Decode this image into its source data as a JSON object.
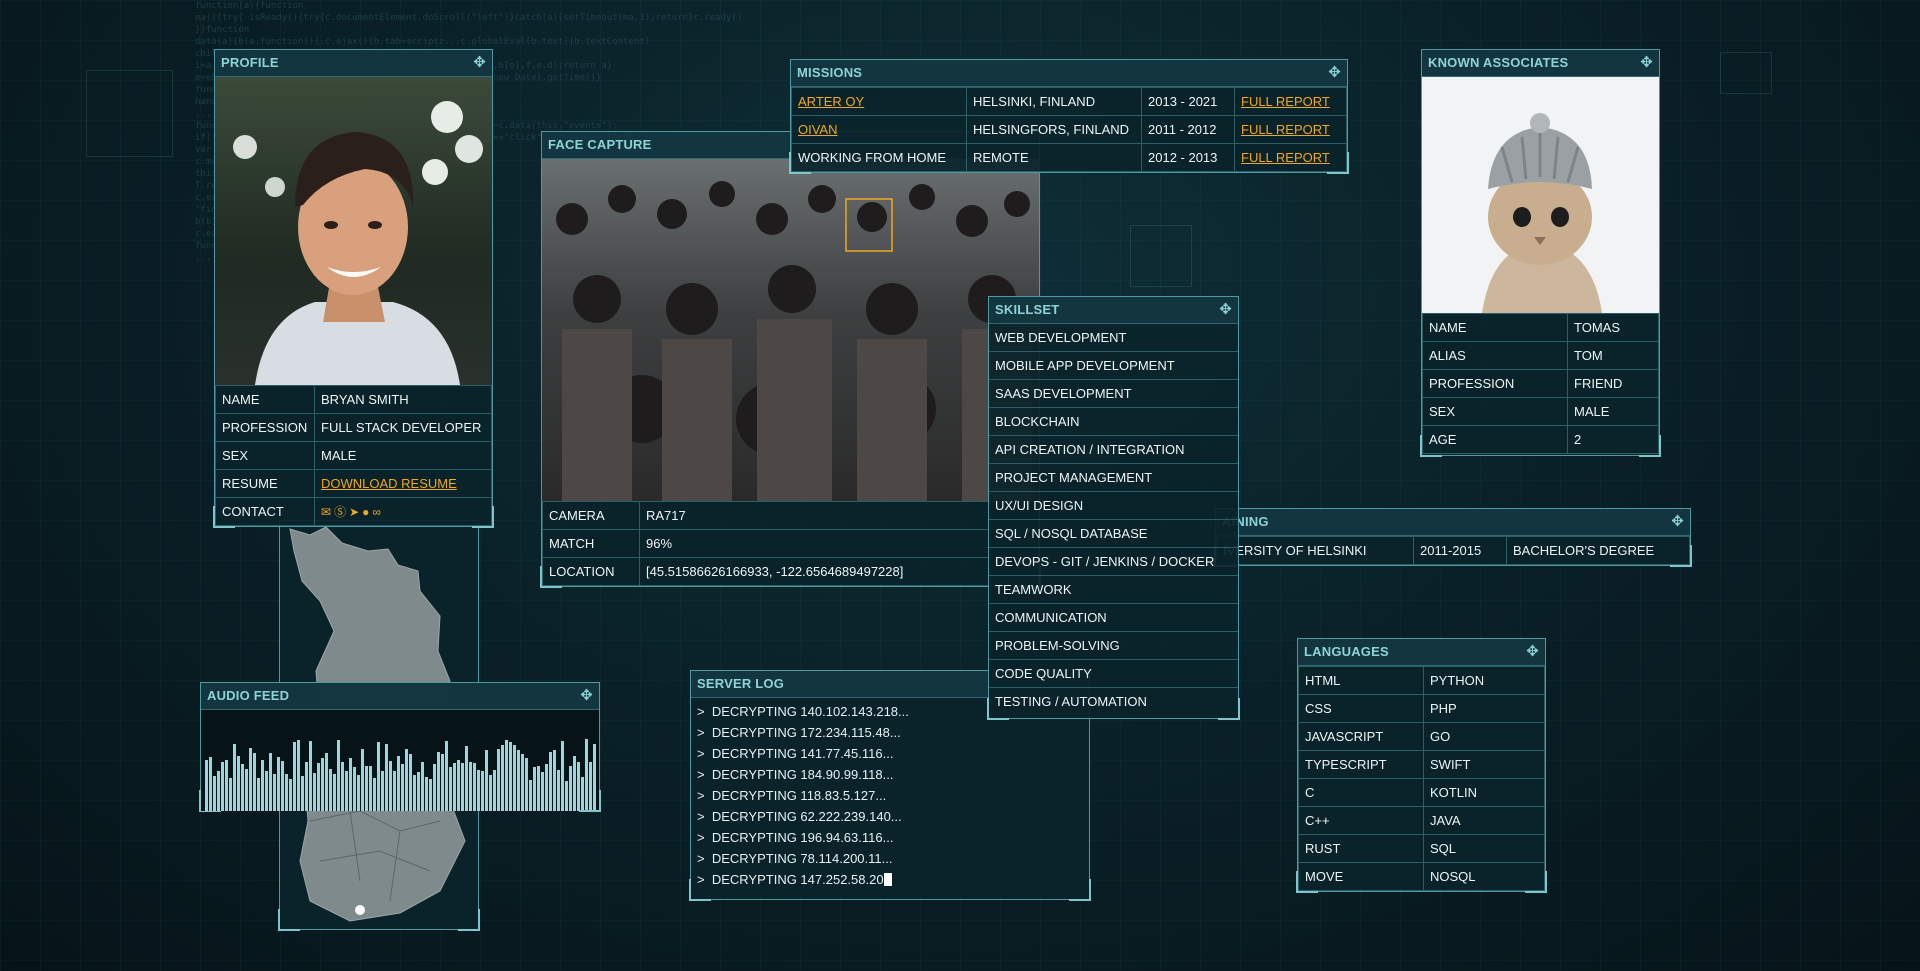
{
  "profile": {
    "title": "PROFILE",
    "rows": [
      {
        "label": "NAME",
        "value": "BRYAN SMITH"
      },
      {
        "label": "PROFESSION",
        "value": "FULL STACK DEVELOPER"
      },
      {
        "label": "SEX",
        "value": "MALE"
      },
      {
        "label": "RESUME",
        "value": "DOWNLOAD RESUME"
      },
      {
        "label": "CONTACT",
        "value": ""
      }
    ],
    "contact_icons": [
      "mail-icon",
      "skype-icon",
      "telegram-icon",
      "github-icon",
      "link-icon"
    ]
  },
  "face_capture": {
    "title": "FACE CAPTURE",
    "rows": [
      {
        "label": "CAMERA",
        "value": "RA717"
      },
      {
        "label": "MATCH",
        "value": "96%"
      },
      {
        "label": "LOCATION",
        "value": "[45.51586626166933, -122.6564689497228]"
      }
    ]
  },
  "missions": {
    "title": "MISSIONS",
    "rows": [
      {
        "company": "ARTER OY",
        "location": "HELSINKI, FINLAND",
        "years": "2013 - 2021",
        "report": "FULL REPORT"
      },
      {
        "company": "OIVAN",
        "location": "HELSINGFORS, FINLAND",
        "years": "2011 - 2012",
        "report": "FULL REPORT"
      },
      {
        "company": "WORKING FROM HOME",
        "location": "REMOTE",
        "years": "2012 - 2013",
        "report": "FULL REPORT"
      }
    ]
  },
  "known_associates": {
    "title": "KNOWN ASSOCIATES",
    "rows": [
      {
        "label": "NAME",
        "value": "TOMAS"
      },
      {
        "label": "ALIAS",
        "value": "TOM"
      },
      {
        "label": "PROFESSION",
        "value": "FRIEND"
      },
      {
        "label": "SEX",
        "value": "MALE"
      },
      {
        "label": "AGE",
        "value": "2"
      }
    ]
  },
  "skillset": {
    "title": "SKILLSET",
    "items": [
      "WEB DEVELOPMENT",
      "MOBILE APP DEVELOPMENT",
      "SAAS DEVELOPMENT",
      "BLOCKCHAIN",
      "API CREATION / INTEGRATION",
      "PROJECT MANAGEMENT",
      "UX/UI DESIGN",
      "SQL / NOSQL DATABASE",
      "DEVOPS - GIT / JENKINS / DOCKER",
      "TEAMWORK",
      "COMMUNICATION",
      "PROBLEM-SOLVING",
      "CODE QUALITY",
      "TESTING / AUTOMATION"
    ]
  },
  "training": {
    "title": "AINING",
    "row": {
      "school": "IVERSITY OF HELSINKI",
      "years": "2011-2015",
      "degree": "BACHELOR'S DEGREE"
    }
  },
  "languages": {
    "title": "LANGUAGES",
    "rows": [
      [
        "HTML",
        "PYTHON"
      ],
      [
        "CSS",
        "PHP"
      ],
      [
        "JAVASCRIPT",
        "GO"
      ],
      [
        "TYPESCRIPT",
        "SWIFT"
      ],
      [
        "C",
        "KOTLIN"
      ],
      [
        "C++",
        "JAVA"
      ],
      [
        "RUST",
        "SQL"
      ],
      [
        "MOVE",
        "NOSQL"
      ]
    ]
  },
  "audio_feed": {
    "title": "AUDIO FEED"
  },
  "server_log": {
    "title": "SERVER LOG",
    "prompt": ">",
    "lines": [
      "DECRYPTING 140.102.143.218...",
      "DECRYPTING 172.234.115.48...",
      "DECRYPTING 141.77.45.116...",
      "DECRYPTING 184.90.99.118...",
      "DECRYPTING 118.83.5.127...",
      "DECRYPTING 62.222.239.140...",
      "DECRYPTING 196.94.63.116...",
      "DECRYPTING 78.114.200.11...",
      "DECRYPTING 147.252.58.20"
    ]
  },
  "map": {},
  "colors": {
    "accent": "#8ed3d8",
    "link": "#f0a820",
    "panel_border": "#4f9aa2"
  }
}
